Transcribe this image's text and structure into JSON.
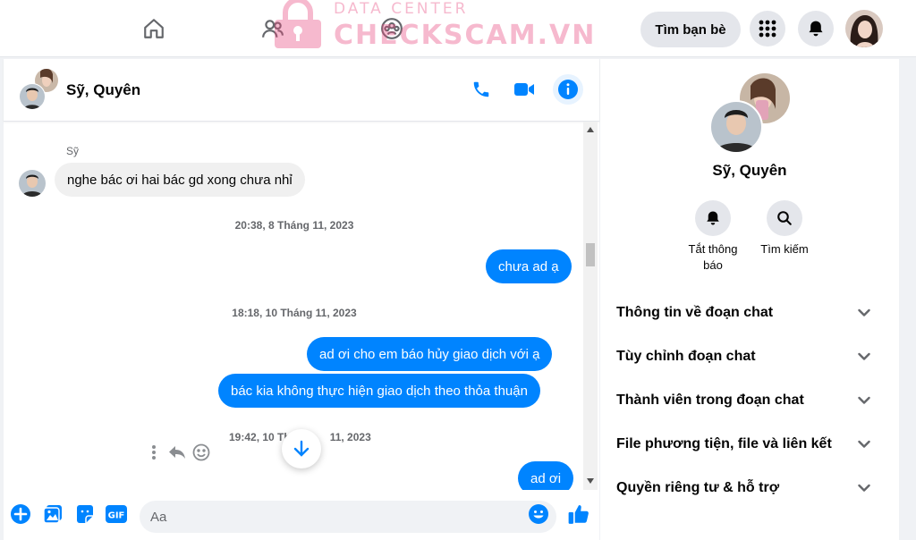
{
  "watermark": {
    "top": "DATA CENTER",
    "main": "CHECKSCAM.VN"
  },
  "topbar": {
    "find_friends": "Tìm bạn bè"
  },
  "chat": {
    "title": "Sỹ, Quyên",
    "input_placeholder": "Aa"
  },
  "messages": [
    {
      "kind": "sender",
      "text": "Sỹ"
    },
    {
      "kind": "incoming",
      "text": "nghe bác ơi hai bác gd xong chưa nhỉ"
    },
    {
      "kind": "timestamp",
      "text": "20:38, 8 Tháng 11, 2023"
    },
    {
      "kind": "outgoing",
      "text": "chưa ad ạ"
    },
    {
      "kind": "timestamp",
      "text": "18:18, 10 Tháng 11, 2023"
    },
    {
      "kind": "outgoing",
      "text": "ad ơi cho em báo hủy giao dịch với ạ"
    },
    {
      "kind": "outgoing",
      "text": "bác kia không thực hiện giao dịch theo thỏa thuận"
    },
    {
      "kind": "timestamp",
      "text": "19:42, 10 Th",
      "text_end": "11, 2023"
    },
    {
      "kind": "outgoing",
      "text": "ad ơi"
    }
  ],
  "info": {
    "name": "Sỹ, Quyên",
    "actions": [
      {
        "label": "Tắt thông báo",
        "icon": "bell-icon"
      },
      {
        "label": "Tìm kiếm",
        "icon": "search-icon"
      }
    ],
    "sections": [
      "Thông tin về đoạn chat",
      "Tùy chỉnh đoạn chat",
      "Thành viên trong đoạn chat",
      "File phương tiện, file và liên kết",
      "Quyền riêng tư & hỗ trợ"
    ]
  },
  "colors": {
    "accent": "#0084ff",
    "incoming_bubble": "#f0f0f0",
    "watermark": "#e84a7f"
  }
}
